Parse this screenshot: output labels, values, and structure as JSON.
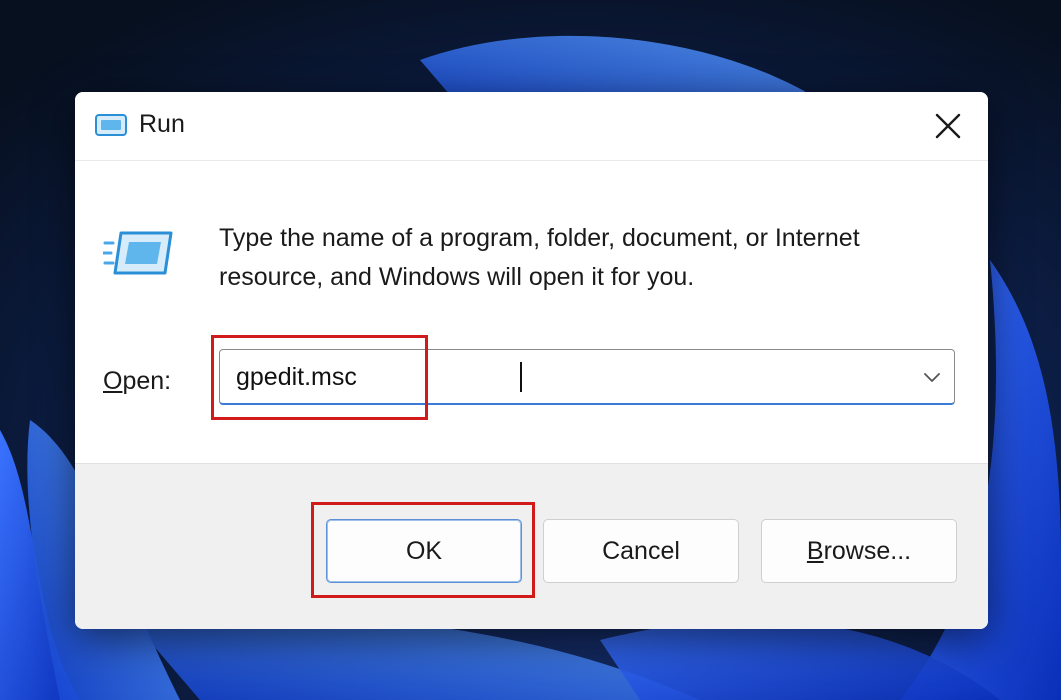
{
  "dialog": {
    "title": "Run",
    "icon": "run-icon",
    "close_icon": "close-icon"
  },
  "body": {
    "description": "Type the name of a program, folder, document, or Internet resource, and Windows will open it for you.",
    "icon": "run-icon",
    "open_label_mnemonic": "O",
    "open_label_rest": "pen:",
    "input_value": "gpedit.msc",
    "dropdown_icon": "chevron-down-icon"
  },
  "buttons": {
    "ok": "OK",
    "cancel": "Cancel",
    "browse_mnemonic": "B",
    "browse_rest": "rowse..."
  },
  "colors": {
    "highlight": "#d11a1a",
    "focus_accent": "#3a7bd5"
  }
}
